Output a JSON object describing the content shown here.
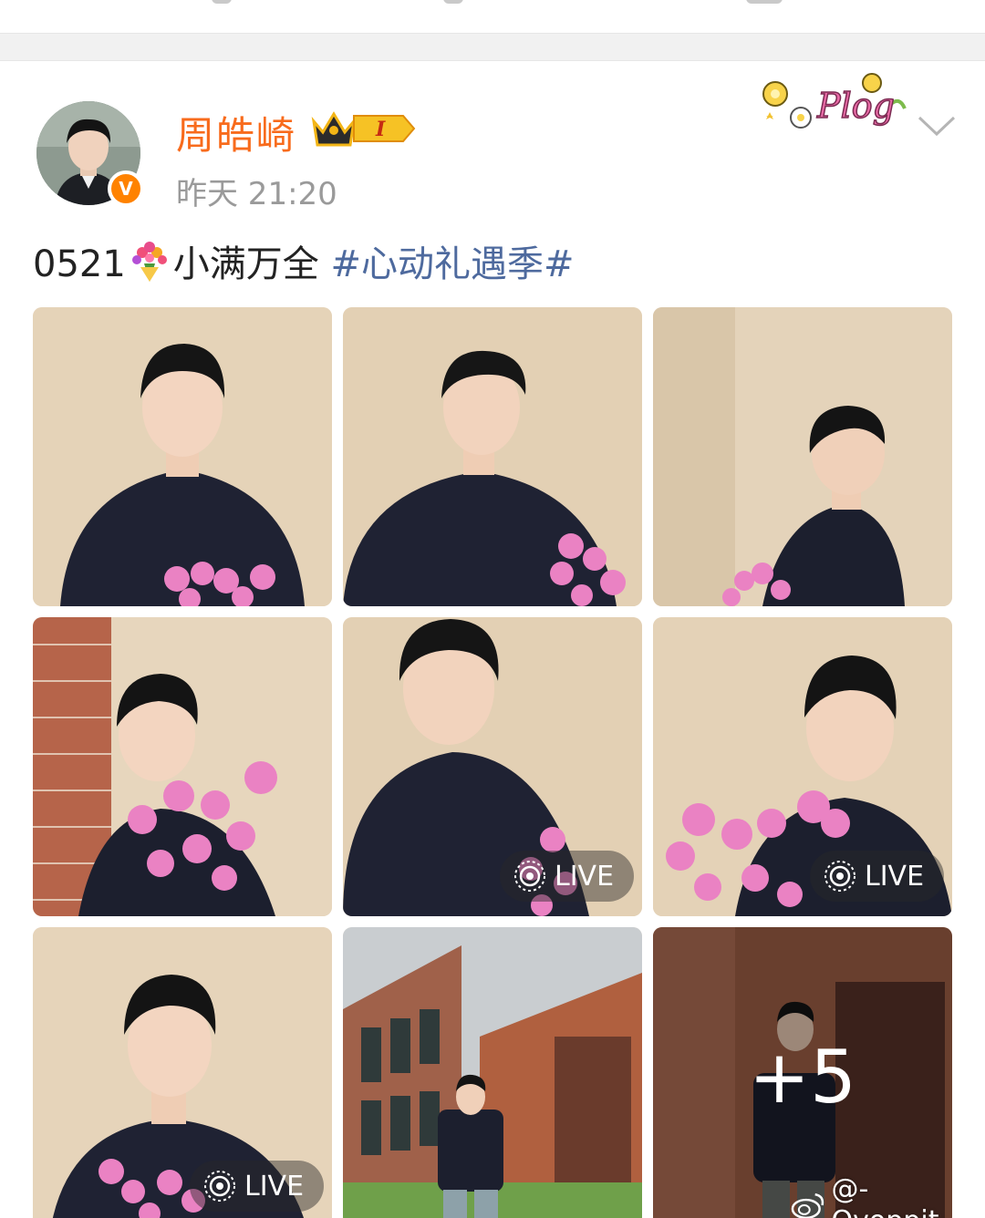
{
  "post": {
    "author": {
      "name": "周皓崎",
      "verified_badge": "V",
      "avatar_icon": "avatar-photo",
      "level_badge_text": "I"
    },
    "timestamp": "昨天 21:20",
    "sticker_text": "Plog",
    "text": {
      "prefix": "0521",
      "emoji": "bouquet-emoji",
      "body": "小满万全 ",
      "hashtag": "#心动礼遇季#"
    },
    "photos": [
      {
        "id": 1,
        "live": false,
        "live_label": ""
      },
      {
        "id": 2,
        "live": false,
        "live_label": ""
      },
      {
        "id": 3,
        "live": false,
        "live_label": ""
      },
      {
        "id": 4,
        "live": false,
        "live_label": ""
      },
      {
        "id": 5,
        "live": true,
        "live_label": "LIVE"
      },
      {
        "id": 6,
        "live": true,
        "live_label": "LIVE"
      },
      {
        "id": 7,
        "live": true,
        "live_label": "LIVE"
      },
      {
        "id": 8,
        "live": false,
        "live_label": ""
      },
      {
        "id": 9,
        "live": false,
        "live_label": "",
        "more_count": "+5"
      }
    ],
    "watermark": "@-Ovoppit-"
  },
  "colors": {
    "username": "#f86b1c",
    "hashtag": "#4e6a9e",
    "timestamp": "#9a9a9a",
    "verified": "#ff8200"
  }
}
